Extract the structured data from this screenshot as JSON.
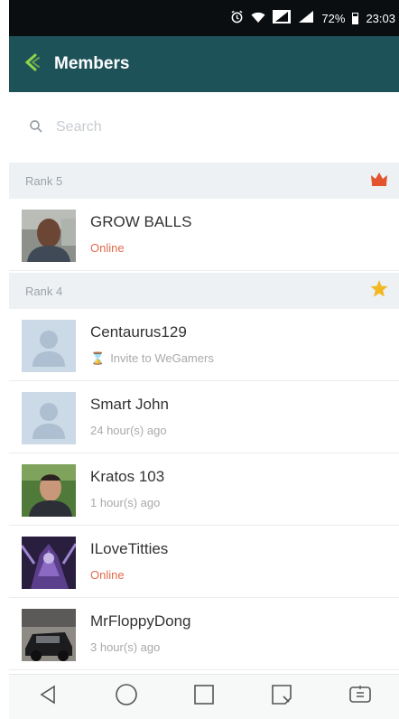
{
  "status_bar": {
    "battery": "72%",
    "battery_level": 0.72,
    "time": "23:03"
  },
  "header": {
    "title": "Members"
  },
  "search": {
    "placeholder": "Search"
  },
  "sections": [
    {
      "label": "Rank 5",
      "badge_icon": "crown-icon",
      "badge_color": "#e2532e",
      "members": [
        {
          "name": "GROW BALLS",
          "status": "Online",
          "online": true,
          "avatar": "photo"
        }
      ]
    },
    {
      "label": "Rank 4",
      "badge_icon": "star-icon",
      "badge_color": "#f2b822",
      "members": [
        {
          "name": "Centaurus129",
          "status": "Invite to WeGamers",
          "online": false,
          "avatar": "placeholder",
          "status_icon": "hourglass-icon"
        },
        {
          "name": "Smart John",
          "status": "24 hour(s) ago",
          "online": false,
          "avatar": "placeholder"
        },
        {
          "name": "Kratos 103",
          "status": "1 hour(s) ago",
          "online": false,
          "avatar": "photo"
        },
        {
          "name": "ILoveTitties",
          "status": "Online",
          "online": true,
          "avatar": "photo"
        },
        {
          "name": "MrFloppyDong",
          "status": "3 hour(s) ago",
          "online": false,
          "avatar": "photo"
        }
      ]
    }
  ],
  "colors": {
    "app_bar": "#1e5259",
    "online": "#e06a4e",
    "section_bg": "#eef1f3"
  },
  "nav_bar": {
    "buttons": [
      "back-icon",
      "home-icon",
      "recents-icon",
      "capture-icon",
      "dual-window-icon"
    ]
  }
}
